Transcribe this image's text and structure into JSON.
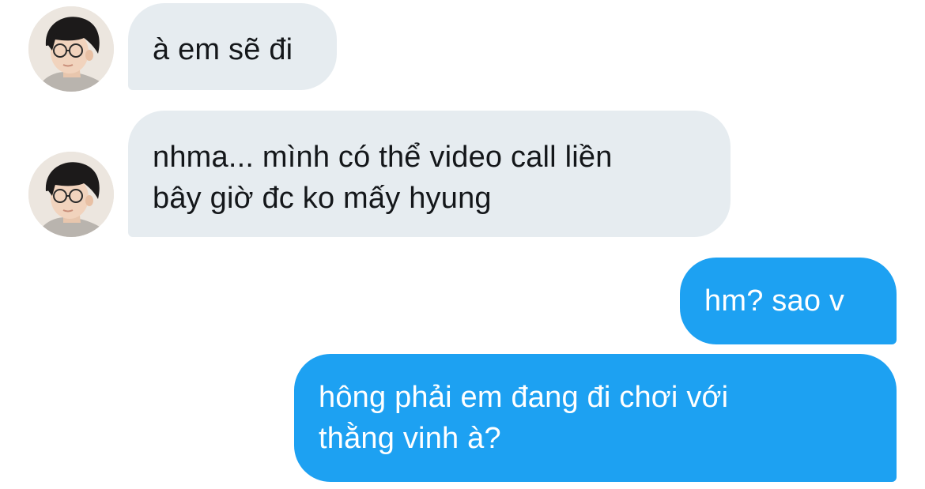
{
  "conversation": {
    "messages": [
      {
        "sender": "contact",
        "text": "à em sẽ đi"
      },
      {
        "sender": "contact",
        "text": "nhma... mình có thể video call liền\nbây giờ đc ko mấy hyung"
      },
      {
        "sender": "me",
        "text": "hm? sao v"
      },
      {
        "sender": "me",
        "text": "hông phải em đang đi chơi với\nthằng vinh à?"
      }
    ]
  },
  "colors": {
    "incoming_bubble": "#e6ecf0",
    "outgoing_bubble": "#1da1f2",
    "incoming_text": "#14171a",
    "outgoing_text": "#ffffff"
  },
  "icons": {
    "contact_avatar": "contact-avatar-photo"
  }
}
